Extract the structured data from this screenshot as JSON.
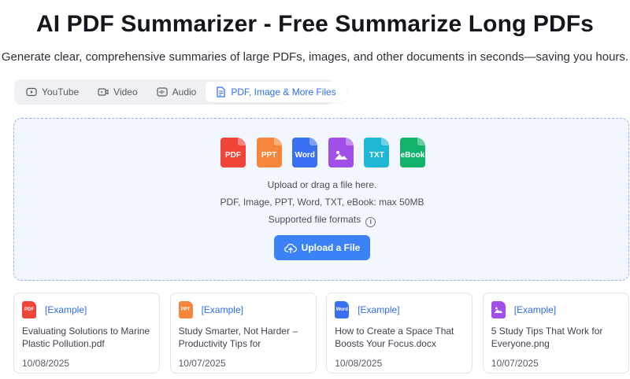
{
  "header": {
    "title": "AI PDF Summarizer - Free Summarize Long PDFs",
    "subtitle": "Generate clear, comprehensive summaries of large PDFs, images, and other documents in seconds—saving you hours."
  },
  "tabs": [
    {
      "label": "YouTube",
      "icon": "youtube-icon",
      "active": false
    },
    {
      "label": "Video",
      "icon": "video-icon",
      "active": false
    },
    {
      "label": "Audio",
      "icon": "audio-icon",
      "active": false
    },
    {
      "label": "PDF, Image & More Files",
      "icon": "file-icon",
      "active": true
    }
  ],
  "upload": {
    "file_types": [
      {
        "label": "PDF",
        "color": "#f04438"
      },
      {
        "label": "PPT",
        "color": "#f7853b"
      },
      {
        "label": "Word",
        "color": "#3970f3"
      },
      {
        "label": "",
        "icon": "image-icon",
        "color": "#a24ee8"
      },
      {
        "label": "TXT",
        "color": "#1eb8d6"
      },
      {
        "label": "eBook",
        "color": "#13b36b"
      }
    ],
    "prompt": "Upload or drag a file here.",
    "limits": "PDF, Image, PPT, Word, TXT, eBook: max 50MB",
    "formats_label": "Supported file formats",
    "info_icon": "info-icon",
    "button_label": "Upload a File",
    "button_icon": "cloud-upload-icon",
    "accent": "#3b82f6"
  },
  "examples": [
    {
      "tag": "[Example]",
      "type": "PDF",
      "color": "#f04438",
      "title": "Evaluating Solutions to Marine Plastic Pollution.pdf",
      "date": "10/08/2025"
    },
    {
      "tag": "[Example]",
      "type": "PPT",
      "color": "#f7853b",
      "title": "Study Smarter, Not Harder – Productivity Tips for",
      "date": "10/07/2025"
    },
    {
      "tag": "[Example]",
      "type": "Word",
      "color": "#3970f3",
      "title": "How to Create a Space That Boosts Your Focus.docx",
      "date": "10/08/2025"
    },
    {
      "tag": "[Example]",
      "type": "",
      "icon": "image-icon",
      "color": "#a24ee8",
      "title": "5 Study Tips That Work for Everyone.png",
      "date": "10/07/2025"
    }
  ]
}
